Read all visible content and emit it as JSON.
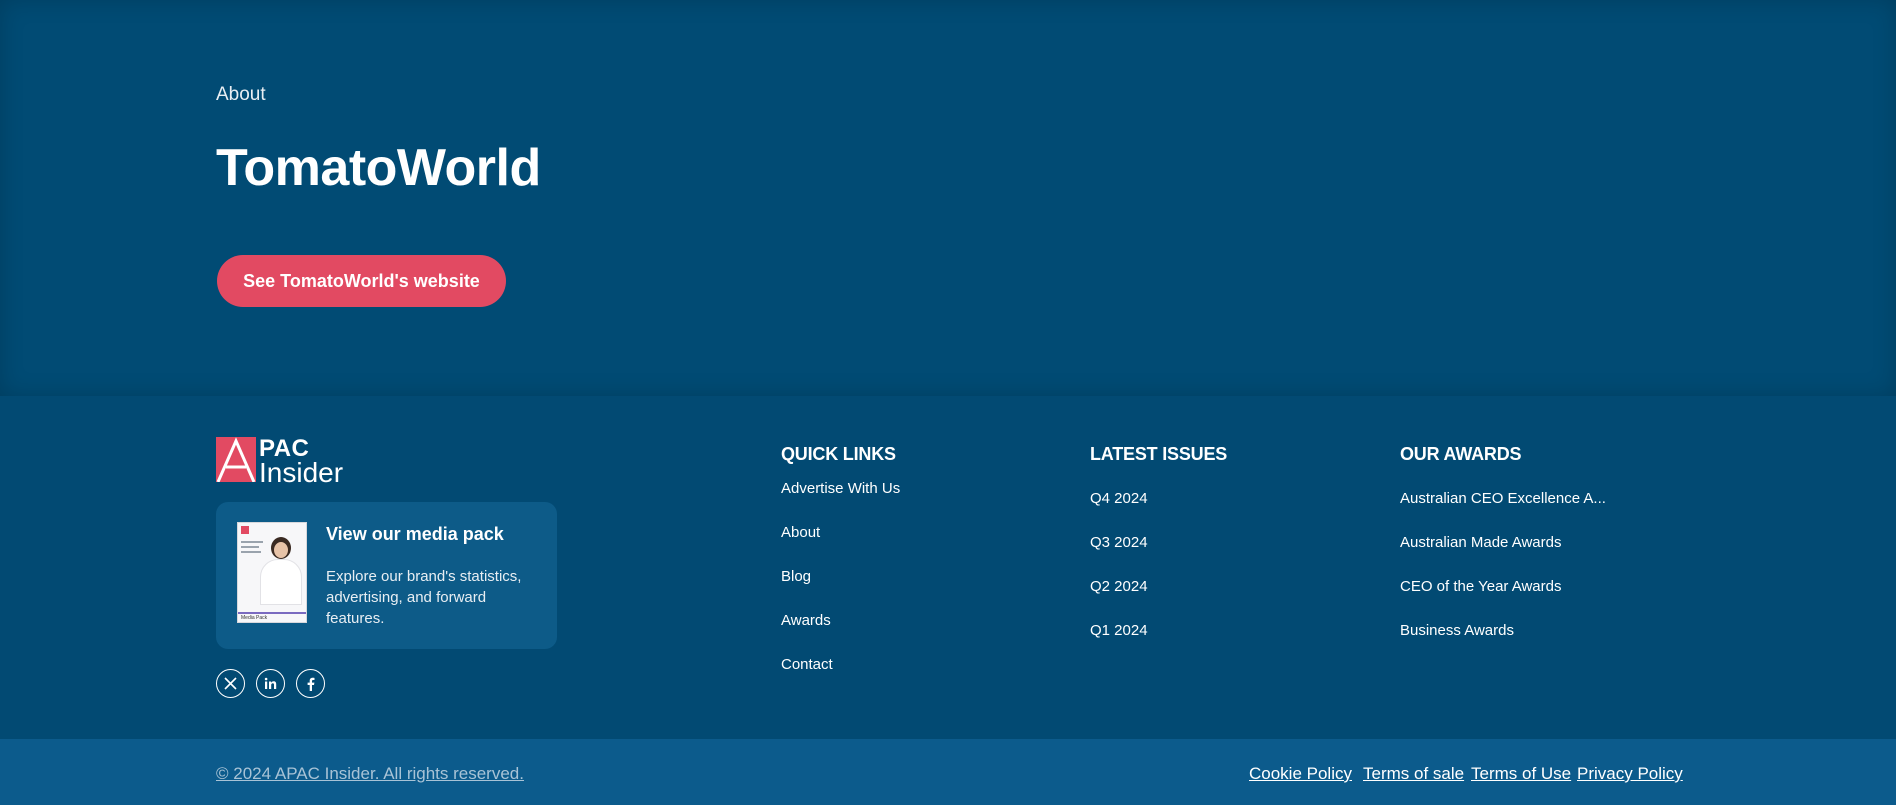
{
  "about": {
    "eyebrow": "About",
    "title": "TomatoWorld",
    "cta_label": "See TomatoWorld's website"
  },
  "footer": {
    "logo": {
      "line1": "PAC",
      "line2": "Insider"
    },
    "media_pack": {
      "title": "View our media pack",
      "description": "Explore our brand's statistics, advertising, and forward features.",
      "thumb_label": "Media Pack"
    },
    "socials": [
      {
        "icon": "x-icon"
      },
      {
        "icon": "linkedin-icon"
      },
      {
        "icon": "facebook-icon"
      }
    ],
    "quick_links": {
      "title": "QUICK LINKS",
      "items": [
        "Advertise With Us",
        "About",
        "Blog",
        "Awards",
        "Contact"
      ]
    },
    "latest_issues": {
      "title": "LATEST ISSUES",
      "items": [
        "Q4 2024",
        "Q3 2024",
        "Q2 2024",
        "Q1 2024"
      ]
    },
    "our_awards": {
      "title": "OUR AWARDS",
      "items": [
        "Australian CEO Excellence A...",
        "Australian Made Awards",
        "CEO of the Year Awards",
        "Business Awards"
      ]
    }
  },
  "bottom_bar": {
    "copyright": "© 2024 APAC Insider. All rights reserved.",
    "legal_links": [
      "Cookie Policy",
      "Terms of sale",
      "Terms of Use",
      "Privacy Policy"
    ]
  },
  "colors": {
    "background": "#024b74",
    "bottom_bar": "#0c5b8c",
    "accent": "#e24a62",
    "card": "#0d5b88"
  }
}
